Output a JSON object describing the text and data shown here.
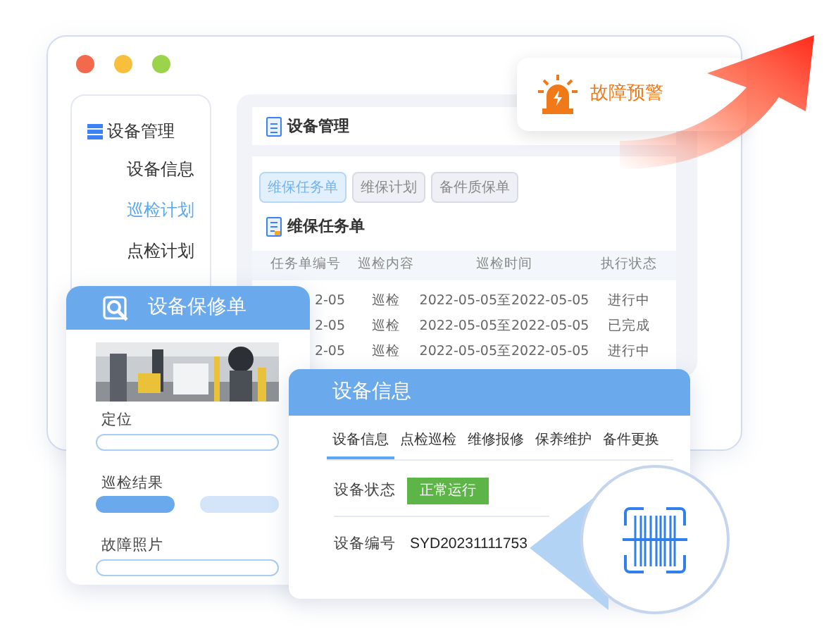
{
  "sidebar": {
    "title": "设备管理",
    "items": [
      {
        "label": "设备信息",
        "selected": false
      },
      {
        "label": "巡检计划",
        "selected": true
      },
      {
        "label": "点检计划",
        "selected": false
      }
    ]
  },
  "main_panel": {
    "title": "设备管理",
    "tabs": [
      {
        "label": "维保任务单",
        "selected": true
      },
      {
        "label": "维保计划",
        "selected": false
      },
      {
        "label": "备件质保单",
        "selected": false
      }
    ],
    "section_title": "维保任务单",
    "table": {
      "columns": [
        "任务单编号",
        "巡检内容",
        "巡检时间",
        "执行状态"
      ],
      "rows": [
        [
          "2-05",
          "巡检",
          "2022-05-05至2022-05-05",
          "进行中"
        ],
        [
          "2-05",
          "巡检",
          "2022-05-05至2022-05-05",
          "已完成"
        ],
        [
          "2-05",
          "巡检",
          "2022-05-05至2022-05-05",
          "进行中"
        ]
      ]
    }
  },
  "alert": {
    "label": "故障预警"
  },
  "repair_card": {
    "title": "设备保修单",
    "fields": [
      {
        "label": "定位",
        "kind": "field"
      },
      {
        "label": "巡检结果",
        "kind": "choice"
      },
      {
        "label": "故障照片",
        "kind": "field"
      }
    ]
  },
  "info_card": {
    "title": "设备信息",
    "tabs": [
      {
        "label": "设备信息",
        "selected": true
      },
      {
        "label": "点检巡检",
        "selected": false
      },
      {
        "label": "维修报修",
        "selected": false
      },
      {
        "label": "保养维护",
        "selected": false
      },
      {
        "label": "备件更换",
        "selected": false
      }
    ],
    "status": {
      "label": "设备状态",
      "value": "正常运行"
    },
    "number": {
      "label": "设备编号",
      "value": "SYD20231111753"
    }
  }
}
